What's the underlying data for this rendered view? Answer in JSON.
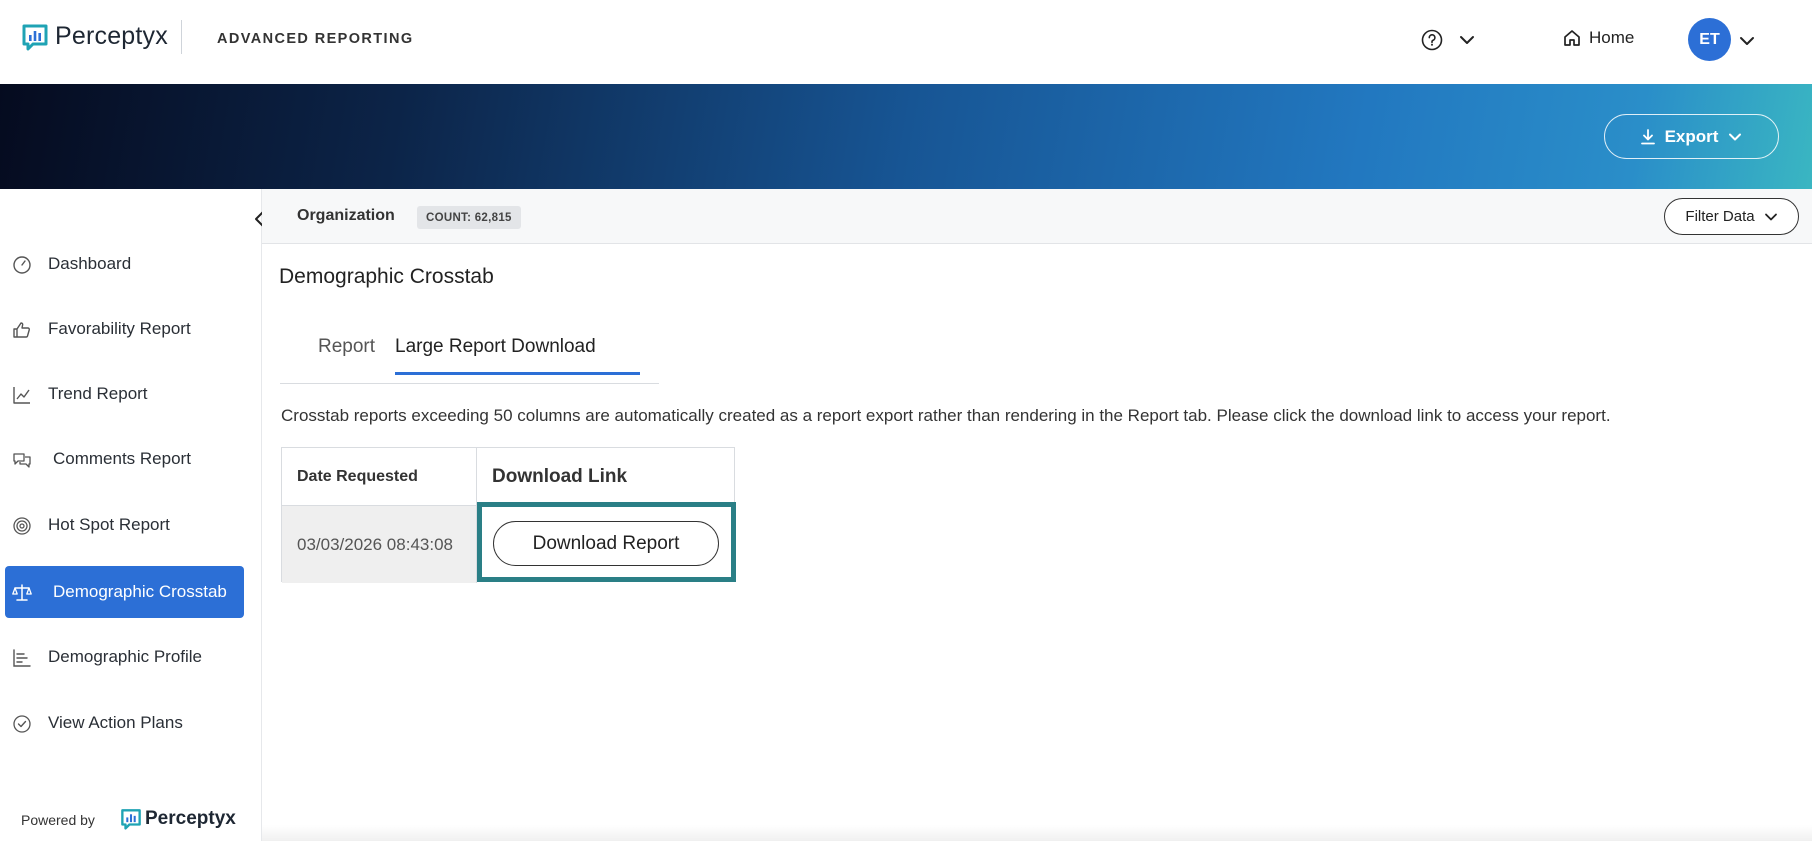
{
  "header": {
    "brand": "Perceptyx",
    "app_title": "ADVANCED REPORTING",
    "home_label": "Home",
    "avatar_initials": "ET",
    "icons": [
      "help-icon",
      "chevron-down-icon",
      "home-icon"
    ]
  },
  "banner": {
    "export_label": "Export"
  },
  "sidebar": {
    "items": [
      {
        "label": "Dashboard",
        "icon": "dashboard-gauge-icon",
        "active": false
      },
      {
        "label": "Favorability Report",
        "icon": "thumbs-up-icon",
        "active": false
      },
      {
        "label": "Trend Report",
        "icon": "line-chart-icon",
        "active": false
      },
      {
        "label": "Comments Report",
        "icon": "chat-bubbles-icon",
        "active": false
      },
      {
        "label": "Hot Spot Report",
        "icon": "target-icon",
        "active": false
      },
      {
        "label": "Demographic Crosstab",
        "icon": "scale-icon",
        "active": true
      },
      {
        "label": "Demographic Profile",
        "icon": "bar-list-icon",
        "active": false
      },
      {
        "label": "View Action Plans",
        "icon": "check-circle-icon",
        "active": false
      }
    ],
    "powered_by": "Powered by",
    "powered_brand": "Perceptyx"
  },
  "orgbar": {
    "label": "Organization",
    "count": "COUNT: 62,815",
    "filter_label": "Filter Data"
  },
  "main": {
    "title": "Demographic Crosstab",
    "tabs": [
      {
        "label": "Report",
        "selected": false
      },
      {
        "label": "Large Report Download",
        "selected": true
      }
    ],
    "info": "Crosstab reports exceeding 50 columns are automatically created as a report export rather than rendering in the Report tab. Please click the download link to access your report.",
    "table": {
      "headers": [
        "Date Requested",
        "Download Link"
      ],
      "rows": [
        {
          "date": "03/03/2026 08:43:08",
          "action": "Download Report"
        }
      ]
    }
  },
  "colors": {
    "accent": "#2c6fd6",
    "focus_ring": "#2a7f86"
  }
}
